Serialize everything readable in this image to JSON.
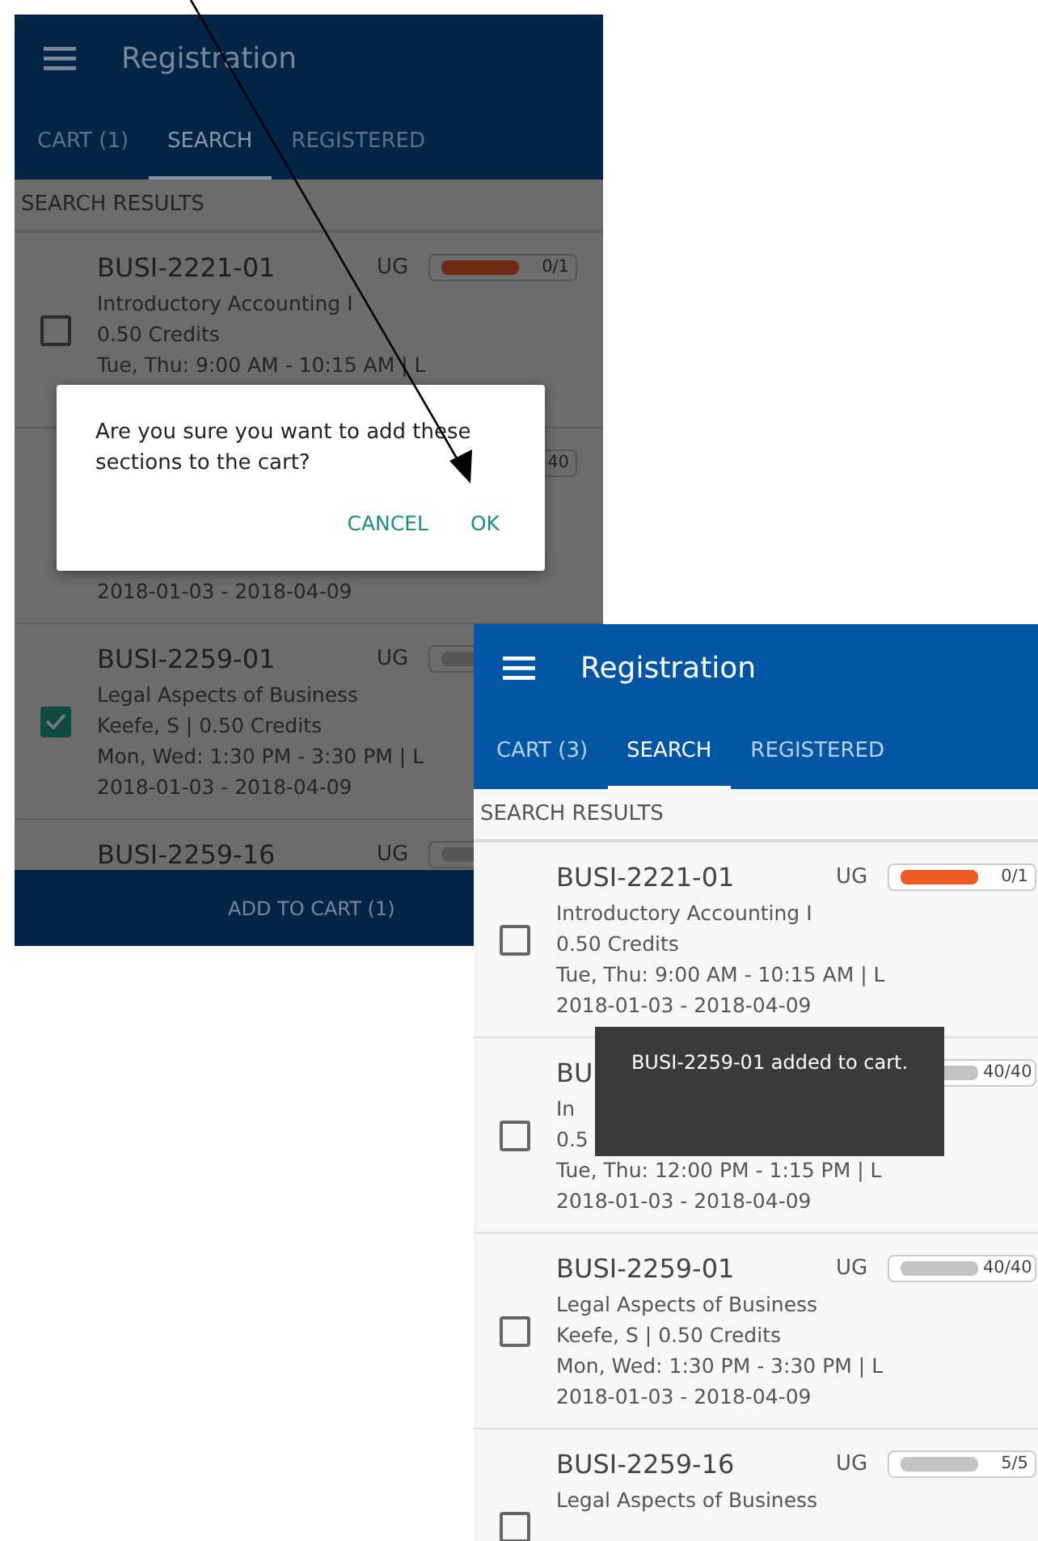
{
  "screens": [
    {
      "dimmed": true,
      "title": "Registration",
      "tabs": [
        {
          "label": "CART (1)",
          "selected": false
        },
        {
          "label": "SEARCH",
          "selected": true
        },
        {
          "label": "REGISTERED",
          "selected": false
        }
      ],
      "section": "SEARCH RESULTS",
      "rows": [
        {
          "checked": false,
          "code": "BUSI-2221-01",
          "level_tag": "UG",
          "capacity": {
            "text": "0/1",
            "color": "#6e2a12"
          },
          "lines": [
            "Introductory Accounting I",
            "0.50 Credits",
            "Tue, Thu: 9:00 AM - 10:15 AM | L"
          ]
        },
        {
          "capacity": {
            "text": "40"
          },
          "dates": "2018-01-03 - 2018-04-09"
        },
        {
          "checked": true,
          "code": "BUSI-2259-01",
          "level_tag": "UG",
          "capacity": {
            "color": "#575757"
          },
          "lines": [
            "Legal Aspects of Business",
            "Keefe, S | 0.50 Credits",
            "Mon, Wed: 1:30 PM - 3:30 PM | L"
          ],
          "dates": "2018-01-03 - 2018-04-09"
        },
        {
          "code": "BUSI-2259-16",
          "level_tag": "UG",
          "capacity": {
            "color": "#575757"
          }
        }
      ],
      "bottom_button": "ADD TO CART (1)",
      "dialog": {
        "message": "Are you sure you want to add these sections to the cart?",
        "buttons": [
          "CANCEL",
          "OK"
        ]
      }
    },
    {
      "dimmed": false,
      "title": "Registration",
      "tabs": [
        {
          "label": "CART (3)",
          "selected": false
        },
        {
          "label": "SEARCH",
          "selected": true
        },
        {
          "label": "REGISTERED",
          "selected": false
        }
      ],
      "section": "SEARCH RESULTS",
      "rows": [
        {
          "checked": false,
          "code": "BUSI-2221-01",
          "level_tag": "UG",
          "capacity": {
            "text": "0/1",
            "color": "#ee5a24"
          },
          "lines": [
            "Introductory Accounting I",
            "0.50 Credits",
            "Tue, Thu: 9:00 AM - 10:15 AM | L"
          ],
          "dates": "2018-01-03 - 2018-04-09"
        },
        {
          "checked": false,
          "code": "BU",
          "capacity": {
            "text": "40/40",
            "color": "#c4c4c4"
          },
          "lines": [
            "In",
            "0.5",
            "Tue, Thu: 12:00 PM - 1:15 PM | L"
          ],
          "dates": "2018-01-03 - 2018-04-09"
        },
        {
          "checked": false,
          "code": "BUSI-2259-01",
          "level_tag": "UG",
          "capacity": {
            "text": "40/40",
            "color": "#c4c4c4"
          },
          "lines": [
            "Legal Aspects of Business",
            "Keefe, S | 0.50 Credits",
            "Mon, Wed: 1:30 PM - 3:30 PM | L"
          ],
          "dates": "2018-01-03 - 2018-04-09"
        },
        {
          "checked": false,
          "code": "BUSI-2259-16",
          "level_tag": "UG",
          "capacity": {
            "text": "5/5",
            "color": "#c4c4c4"
          },
          "lines": [
            "Legal Aspects of Business"
          ]
        }
      ],
      "toast": "BUSI-2259-01 added to cart."
    }
  ]
}
